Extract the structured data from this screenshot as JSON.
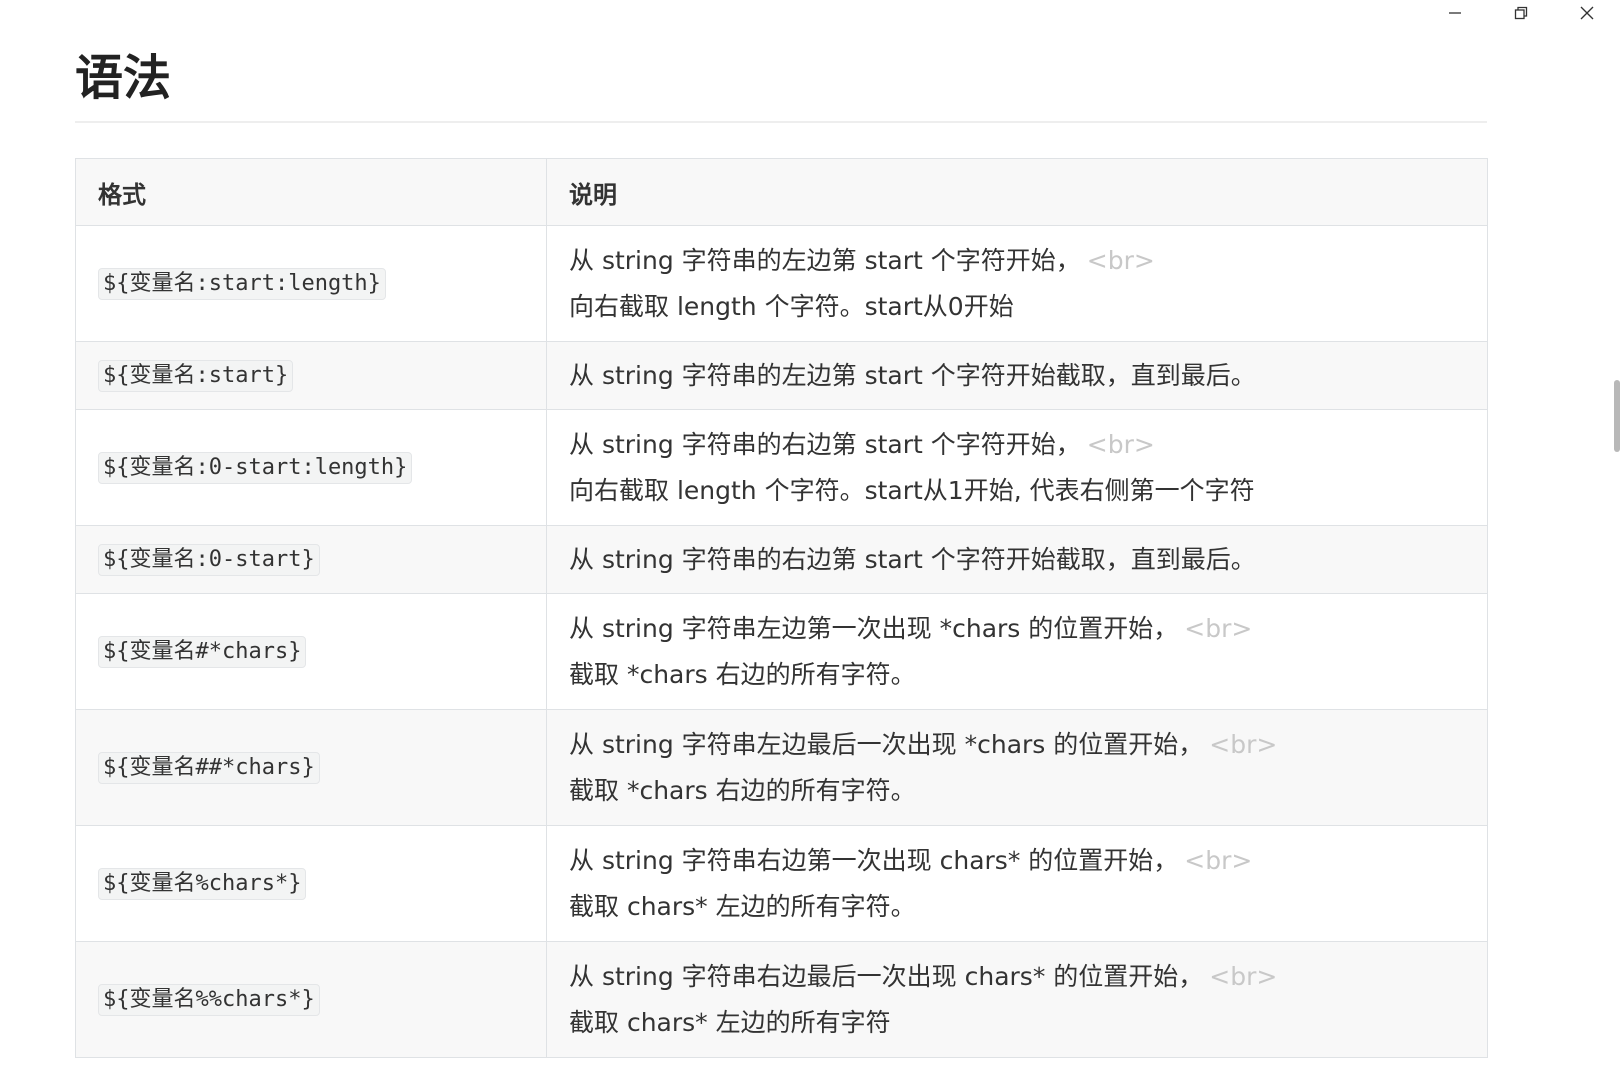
{
  "window_controls": {
    "minimize_icon": "minimize-icon",
    "restore_icon": "restore-icon",
    "close_icon": "close-icon"
  },
  "heading": "语法",
  "table": {
    "headers": [
      "格式",
      "说明"
    ],
    "rows": [
      {
        "format": "${变量名:start:length}",
        "lines": [
          "从 string 字符串的左边第 start 个字符开始，",
          "向右截取 length 个字符。start从0开始"
        ],
        "br": "<br>"
      },
      {
        "format": "${变量名:start}",
        "lines": [
          "从 string 字符串的左边第 start 个字符开始截取，直到最后。"
        ],
        "br": ""
      },
      {
        "format": "${变量名:0-start:length}",
        "lines": [
          "从 string 字符串的右边第 start 个字符开始，",
          "向右截取 length 个字符。start从1开始, 代表右侧第一个字符"
        ],
        "br": "<br>"
      },
      {
        "format": "${变量名:0-start}",
        "lines": [
          "从 string 字符串的右边第 start 个字符开始截取，直到最后。"
        ],
        "br": ""
      },
      {
        "format": "${变量名#*chars}",
        "lines": [
          "从 string 字符串左边第一次出现 *chars 的位置开始，",
          "截取 *chars 右边的所有字符。"
        ],
        "br": "<br>"
      },
      {
        "format": "${变量名##*chars}",
        "lines": [
          "从 string 字符串左边最后一次出现 *chars 的位置开始，",
          "截取 *chars 右边的所有字符。"
        ],
        "br": "<br>"
      },
      {
        "format": "${变量名%chars*}",
        "lines": [
          "从 string 字符串右边第一次出现 chars* 的位置开始，",
          "截取 chars* 左边的所有字符。"
        ],
        "br": "<br>"
      },
      {
        "format": "${变量名%%chars*}",
        "lines": [
          "从 string 字符串右边最后一次出现 chars* 的位置开始，",
          "截取 chars* 左边的所有字符"
        ],
        "br": "<br>"
      }
    ]
  },
  "colors": {
    "text": "#333333",
    "border": "#dfe2e5",
    "stripe": "#f8f8f8",
    "br_tag": "#c8c8c8"
  }
}
